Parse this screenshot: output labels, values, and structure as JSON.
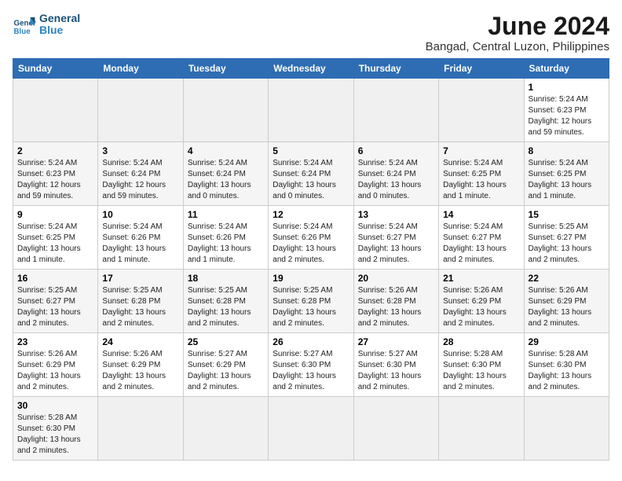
{
  "header": {
    "logo_general": "General",
    "logo_blue": "Blue",
    "month_title": "June 2024",
    "location": "Bangad, Central Luzon, Philippines"
  },
  "days_of_week": [
    "Sunday",
    "Monday",
    "Tuesday",
    "Wednesday",
    "Thursday",
    "Friday",
    "Saturday"
  ],
  "weeks": [
    [
      {
        "day": null,
        "info": null
      },
      {
        "day": null,
        "info": null
      },
      {
        "day": null,
        "info": null
      },
      {
        "day": null,
        "info": null
      },
      {
        "day": null,
        "info": null
      },
      {
        "day": null,
        "info": null
      },
      {
        "day": "1",
        "info": "Sunrise: 5:24 AM\nSunset: 6:23 PM\nDaylight: 12 hours\nand 59 minutes."
      }
    ],
    [
      {
        "day": "2",
        "info": "Sunrise: 5:24 AM\nSunset: 6:23 PM\nDaylight: 12 hours\nand 59 minutes."
      },
      {
        "day": "3",
        "info": "Sunrise: 5:24 AM\nSunset: 6:24 PM\nDaylight: 12 hours\nand 59 minutes."
      },
      {
        "day": "4",
        "info": "Sunrise: 5:24 AM\nSunset: 6:24 PM\nDaylight: 13 hours\nand 0 minutes."
      },
      {
        "day": "5",
        "info": "Sunrise: 5:24 AM\nSunset: 6:24 PM\nDaylight: 13 hours\nand 0 minutes."
      },
      {
        "day": "6",
        "info": "Sunrise: 5:24 AM\nSunset: 6:24 PM\nDaylight: 13 hours\nand 0 minutes."
      },
      {
        "day": "7",
        "info": "Sunrise: 5:24 AM\nSunset: 6:25 PM\nDaylight: 13 hours\nand 1 minute."
      },
      {
        "day": "8",
        "info": "Sunrise: 5:24 AM\nSunset: 6:25 PM\nDaylight: 13 hours\nand 1 minute."
      }
    ],
    [
      {
        "day": "9",
        "info": "Sunrise: 5:24 AM\nSunset: 6:25 PM\nDaylight: 13 hours\nand 1 minute."
      },
      {
        "day": "10",
        "info": "Sunrise: 5:24 AM\nSunset: 6:26 PM\nDaylight: 13 hours\nand 1 minute."
      },
      {
        "day": "11",
        "info": "Sunrise: 5:24 AM\nSunset: 6:26 PM\nDaylight: 13 hours\nand 1 minute."
      },
      {
        "day": "12",
        "info": "Sunrise: 5:24 AM\nSunset: 6:26 PM\nDaylight: 13 hours\nand 2 minutes."
      },
      {
        "day": "13",
        "info": "Sunrise: 5:24 AM\nSunset: 6:27 PM\nDaylight: 13 hours\nand 2 minutes."
      },
      {
        "day": "14",
        "info": "Sunrise: 5:24 AM\nSunset: 6:27 PM\nDaylight: 13 hours\nand 2 minutes."
      },
      {
        "day": "15",
        "info": "Sunrise: 5:25 AM\nSunset: 6:27 PM\nDaylight: 13 hours\nand 2 minutes."
      }
    ],
    [
      {
        "day": "16",
        "info": "Sunrise: 5:25 AM\nSunset: 6:27 PM\nDaylight: 13 hours\nand 2 minutes."
      },
      {
        "day": "17",
        "info": "Sunrise: 5:25 AM\nSunset: 6:28 PM\nDaylight: 13 hours\nand 2 minutes."
      },
      {
        "day": "18",
        "info": "Sunrise: 5:25 AM\nSunset: 6:28 PM\nDaylight: 13 hours\nand 2 minutes."
      },
      {
        "day": "19",
        "info": "Sunrise: 5:25 AM\nSunset: 6:28 PM\nDaylight: 13 hours\nand 2 minutes."
      },
      {
        "day": "20",
        "info": "Sunrise: 5:26 AM\nSunset: 6:28 PM\nDaylight: 13 hours\nand 2 minutes."
      },
      {
        "day": "21",
        "info": "Sunrise: 5:26 AM\nSunset: 6:29 PM\nDaylight: 13 hours\nand 2 minutes."
      },
      {
        "day": "22",
        "info": "Sunrise: 5:26 AM\nSunset: 6:29 PM\nDaylight: 13 hours\nand 2 minutes."
      }
    ],
    [
      {
        "day": "23",
        "info": "Sunrise: 5:26 AM\nSunset: 6:29 PM\nDaylight: 13 hours\nand 2 minutes."
      },
      {
        "day": "24",
        "info": "Sunrise: 5:26 AM\nSunset: 6:29 PM\nDaylight: 13 hours\nand 2 minutes."
      },
      {
        "day": "25",
        "info": "Sunrise: 5:27 AM\nSunset: 6:29 PM\nDaylight: 13 hours\nand 2 minutes."
      },
      {
        "day": "26",
        "info": "Sunrise: 5:27 AM\nSunset: 6:30 PM\nDaylight: 13 hours\nand 2 minutes."
      },
      {
        "day": "27",
        "info": "Sunrise: 5:27 AM\nSunset: 6:30 PM\nDaylight: 13 hours\nand 2 minutes."
      },
      {
        "day": "28",
        "info": "Sunrise: 5:28 AM\nSunset: 6:30 PM\nDaylight: 13 hours\nand 2 minutes."
      },
      {
        "day": "29",
        "info": "Sunrise: 5:28 AM\nSunset: 6:30 PM\nDaylight: 13 hours\nand 2 minutes."
      }
    ],
    [
      {
        "day": "30",
        "info": "Sunrise: 5:28 AM\nSunset: 6:30 PM\nDaylight: 13 hours\nand 2 minutes."
      },
      {
        "day": null,
        "info": null
      },
      {
        "day": null,
        "info": null
      },
      {
        "day": null,
        "info": null
      },
      {
        "day": null,
        "info": null
      },
      {
        "day": null,
        "info": null
      },
      {
        "day": null,
        "info": null
      }
    ]
  ]
}
